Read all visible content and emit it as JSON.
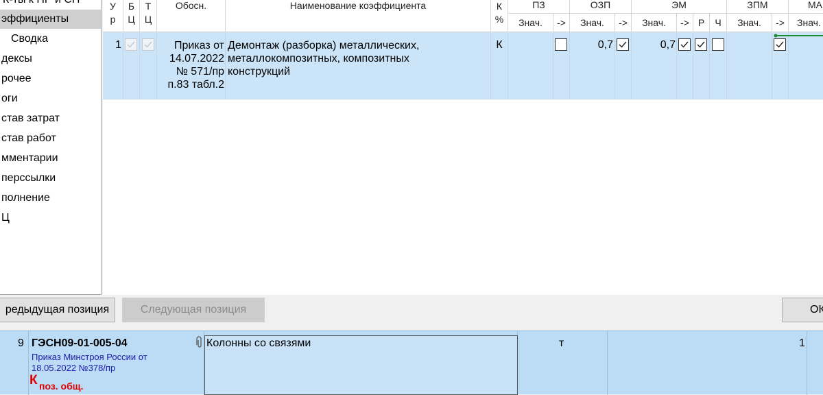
{
  "nav": {
    "items": [
      "К-ты к ПР и СП",
      "эффициенты",
      "Сводка",
      "дексы",
      "рочее",
      "оги",
      "став затрат",
      "став работ",
      "мментарии",
      "перссылки",
      "полнение",
      "Ц"
    ],
    "selected_index": 1
  },
  "grid": {
    "headers": {
      "ur_top": "У",
      "ur_bottom": "р",
      "bc_top": "Б",
      "bc_bottom": "Ц",
      "tc_top": "Т",
      "tc_bottom": "Ц",
      "obosn": "Обосн.",
      "name": "Наименование коэффициента",
      "k_top": "К",
      "k_bottom": "%",
      "pz": "ПЗ",
      "ozp": "ОЗП",
      "em": "ЭМ",
      "zpm": "ЗПМ",
      "ma": "МА",
      "znach": "Знач.",
      "arrow": "->",
      "r": "Р",
      "ch": "Ч"
    },
    "row": {
      "ur": "1",
      "bc_checked": true,
      "tc_checked": true,
      "obosn_lines": [
        "Приказ от",
        "14.07.2022",
        "№ 571/пр",
        "п.83 табл.2"
      ],
      "name_lines": [
        "Демонтаж (разборка) металлических,",
        "металлокомпозитных, композитных",
        "конструкций"
      ],
      "k": "К",
      "pz_value": "",
      "pz_arrow_checked": false,
      "ozp_value": "0,7",
      "ozp_arrow_checked": true,
      "em_value": "0,7",
      "em_arrow_checked": true,
      "em_r_checked": true,
      "em_ch_checked": false,
      "zpm_value": "",
      "zpm_arrow_checked": true
    }
  },
  "buttons": {
    "prev": "редыдущая позиция",
    "next": "Следующая позиция",
    "ok": "ОК"
  },
  "background_table": {
    "row_number": "9",
    "code": "ГЭСН09-01-005-04",
    "source_line1": "Приказ Минстроя России от",
    "source_line2": "18.05.2022 №378/пр",
    "k_letter": "К",
    "k_subscript": "поз. общ.",
    "name": "Колонны со связями",
    "unit": "т",
    "quantity": "1"
  },
  "colors": {
    "selection": "#cce4f7",
    "bg_row": "#bcdcf5",
    "nav_selected": "#cfcfcf",
    "green_marker": "#1e8a2e",
    "red_k": "#e00000",
    "blue_source": "#1a1aa8"
  }
}
